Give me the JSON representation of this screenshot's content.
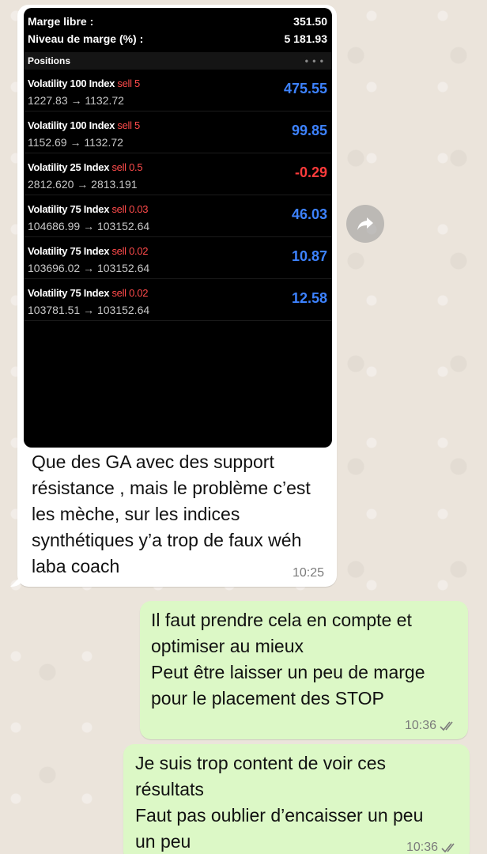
{
  "screenshot": {
    "free_margin_label": "Marge libre :",
    "free_margin_value": "351.50",
    "margin_level_label": "Niveau de marge (%) :",
    "margin_level_value": "5 181.93",
    "positions_label": "Positions",
    "more_label": "• • •",
    "positions": [
      {
        "symbol": "Volatility 100 Index",
        "side": "sell 5",
        "prices": "1227.83 → 1132.72",
        "pnl": "475.55",
        "pnl_color": "#3d82ff"
      },
      {
        "symbol": "Volatility 100 Index",
        "side": "sell 5",
        "prices": "1152.69 → 1132.72",
        "pnl": "99.85",
        "pnl_color": "#3d82ff"
      },
      {
        "symbol": "Volatility 25 Index",
        "side": "sell 0.5",
        "prices": "2812.620 → 2813.191",
        "pnl": "-0.29",
        "pnl_color": "#ff3b3b"
      },
      {
        "symbol": "Volatility 75 Index",
        "side": "sell 0.03",
        "prices": "104686.99 → 103152.64",
        "pnl": "46.03",
        "pnl_color": "#3d82ff"
      },
      {
        "symbol": "Volatility 75 Index",
        "side": "sell 0.02",
        "prices": "103696.02 → 103152.64",
        "pnl": "10.87",
        "pnl_color": "#3d82ff"
      },
      {
        "symbol": "Volatility 75 Index",
        "side": "sell 0.02",
        "prices": "103781.51 → 103152.64",
        "pnl": "12.58",
        "pnl_color": "#3d82ff"
      }
    ]
  },
  "incoming": {
    "text": "Que des GA avec des support résistance , mais le problème c’est les mèche, sur les indices synthétiques y’a trop de faux wéh laba coach",
    "time": "10:25"
  },
  "outgoing": [
    {
      "lines": [
        "Il faut prendre cela en compte et",
        "optimiser au mieux",
        "Peut être laisser un peu de marge",
        "pour le placement des STOP"
      ],
      "time": "10:36"
    },
    {
      "lines": [
        "Je suis trop content de voir ces",
        "résultats",
        "Faut pas oublier d’encaisser un peu",
        "un peu"
      ],
      "time": "10:36"
    }
  ],
  "icons": {
    "forward": "forward-arrow-icon",
    "read_receipt": "double-check-icon"
  },
  "colors": {
    "incoming_bubble": "#ffffff",
    "outgoing_bubble": "#dcf8c6",
    "positive_pnl": "#3d82ff",
    "negative_pnl": "#ff3b3b",
    "sell_label": "#ff4b4b"
  }
}
